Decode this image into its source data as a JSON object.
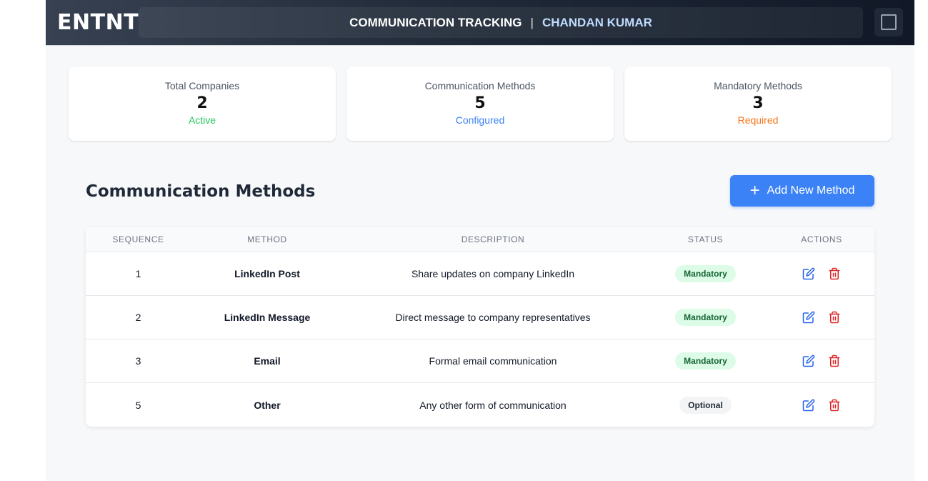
{
  "header": {
    "logo": "ENTNT",
    "title": "COMMUNICATION TRACKING",
    "separator": "|",
    "user": "CHANDAN KUMAR"
  },
  "stats": [
    {
      "label": "Total Companies",
      "value": "2",
      "sub": "Active",
      "color": "#22c55e"
    },
    {
      "label": "Communication Methods",
      "value": "5",
      "sub": "Configured",
      "color": "#3b82f6"
    },
    {
      "label": "Mandatory Methods",
      "value": "3",
      "sub": "Required",
      "color": "#f97316"
    }
  ],
  "section": {
    "title": "Communication Methods",
    "add_button": "Add New Method"
  },
  "table": {
    "headers": [
      "SEQUENCE",
      "METHOD",
      "DESCRIPTION",
      "STATUS",
      "ACTIONS"
    ],
    "rows": [
      {
        "sequence": "1",
        "method": "LinkedIn Post",
        "description": "Share updates on company LinkedIn",
        "status": "Mandatory"
      },
      {
        "sequence": "2",
        "method": "LinkedIn Message",
        "description": "Direct message to company representatives",
        "status": "Mandatory"
      },
      {
        "sequence": "3",
        "method": "Email",
        "description": "Formal email communication",
        "status": "Mandatory"
      },
      {
        "sequence": "5",
        "method": "Other",
        "description": "Any other form of communication",
        "status": "Optional"
      }
    ]
  },
  "icons": {
    "menu": "square-menu-icon",
    "add": "plus-icon",
    "edit": "edit-icon",
    "delete": "trash-icon"
  },
  "colors": {
    "accent": "#3b82f6",
    "delete": "#dc2626",
    "mandatory_bg": "#dcfce7",
    "mandatory_text": "#166534",
    "optional_bg": "#f3f4f6"
  }
}
